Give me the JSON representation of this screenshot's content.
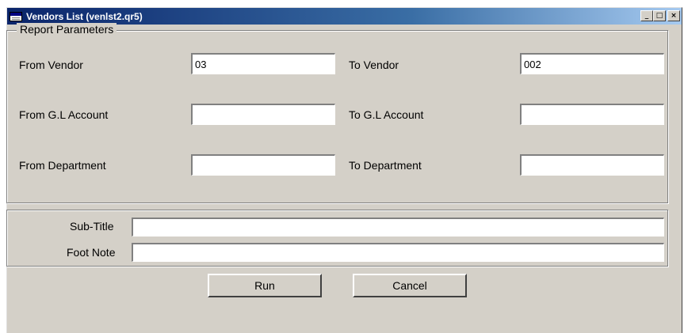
{
  "window": {
    "title": "Vendors List (venlst2.qr5)",
    "buttons": {
      "minimize": "_",
      "maximize": "□",
      "close": "×"
    }
  },
  "parameters": {
    "group_title": "Report Parameters",
    "from_vendor": {
      "label": "From Vendor",
      "value": "03"
    },
    "to_vendor": {
      "label": "To Vendor",
      "value": "002"
    },
    "from_gl": {
      "label": "From G.L Account",
      "value": ""
    },
    "to_gl": {
      "label": "To G.L Account",
      "value": ""
    },
    "from_dept": {
      "label": "From Department",
      "value": ""
    },
    "to_dept": {
      "label": "To Department",
      "value": ""
    }
  },
  "titles": {
    "subtitle": {
      "label": "Sub-Title",
      "value": ""
    },
    "footnote": {
      "label": "Foot Note",
      "value": ""
    }
  },
  "actions": {
    "run_label": "Run",
    "cancel_label": "Cancel"
  }
}
